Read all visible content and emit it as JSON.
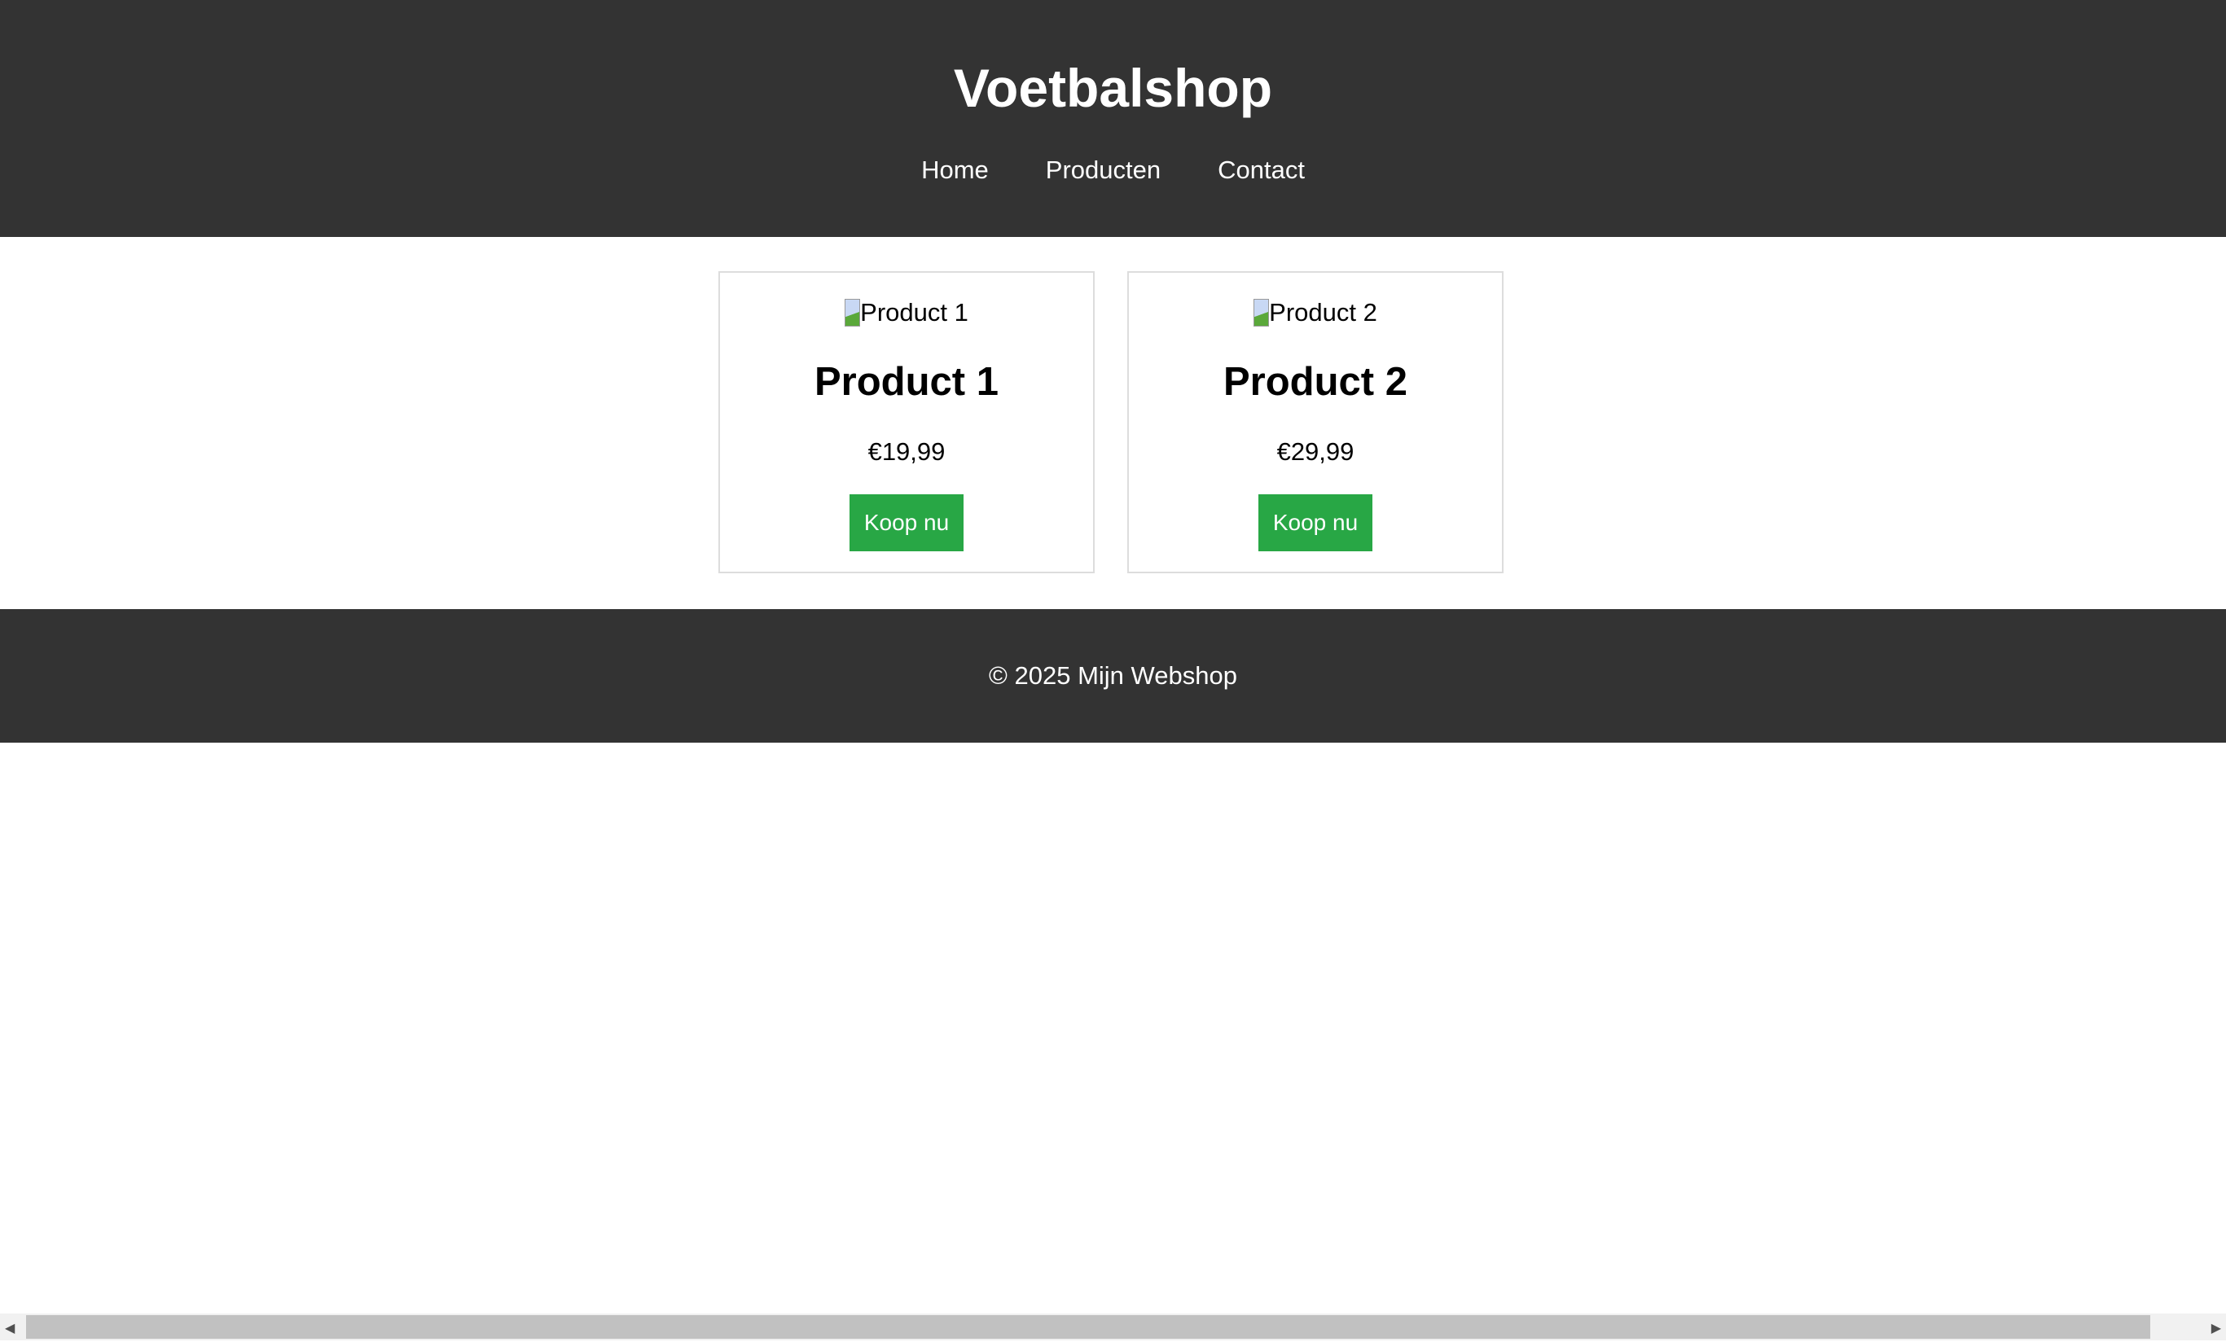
{
  "header": {
    "title": "Voetbalshop",
    "nav": [
      {
        "label": "Home"
      },
      {
        "label": "Producten"
      },
      {
        "label": "Contact"
      }
    ]
  },
  "products": [
    {
      "image_alt": "Product 1",
      "name": "Product 1",
      "price": "€19,99",
      "button": "Koop nu"
    },
    {
      "image_alt": "Product 2",
      "name": "Product 2",
      "price": "€29,99",
      "button": "Koop nu"
    }
  ],
  "footer": {
    "text": "© 2025 Mijn Webshop"
  },
  "colors": {
    "header_bg": "#333333",
    "button": "#28a745"
  }
}
